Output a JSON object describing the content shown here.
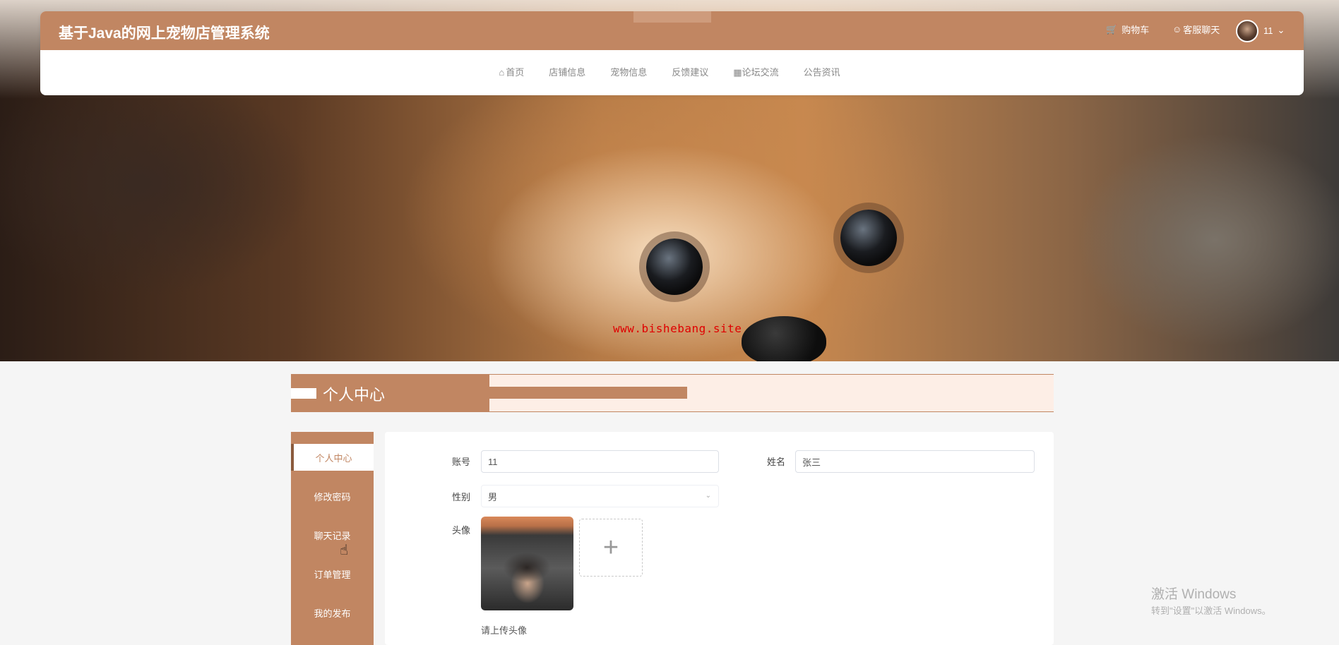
{
  "header": {
    "title": "基于Java的网上宠物店管理系统",
    "cart_label": "购物车",
    "chat_label": "客服聊天",
    "user_name": "11"
  },
  "nav": {
    "items": [
      "首页",
      "店铺信息",
      "宠物信息",
      "反馈建议",
      "论坛交流",
      "公告资讯"
    ]
  },
  "banner": {
    "watermark": "www.bishebang.site"
  },
  "section": {
    "title": "个人中心"
  },
  "sidebar": {
    "items": [
      {
        "label": "个人中心",
        "active": true
      },
      {
        "label": "修改密码",
        "active": false
      },
      {
        "label": "聊天记录",
        "active": false
      },
      {
        "label": "订单管理",
        "active": false
      },
      {
        "label": "我的发布",
        "active": false
      }
    ]
  },
  "form": {
    "account_label": "账号",
    "account_value": "11",
    "name_label": "姓名",
    "name_value": "张三",
    "gender_label": "性别",
    "gender_value": "男",
    "avatar_label": "头像",
    "upload_tip": "请上传头像"
  },
  "os": {
    "activate_title": "激活 Windows",
    "activate_sub": "转到\"设置\"以激活 Windows。"
  },
  "colors": {
    "brand": "#c18662",
    "band_bg": "#fdeee6",
    "watermark": "#e00000"
  },
  "icons": [
    "cart-icon",
    "chat-icon",
    "home-icon",
    "forum-icon",
    "chevron-down-icon",
    "plus-icon",
    "hand-cursor-icon"
  ]
}
